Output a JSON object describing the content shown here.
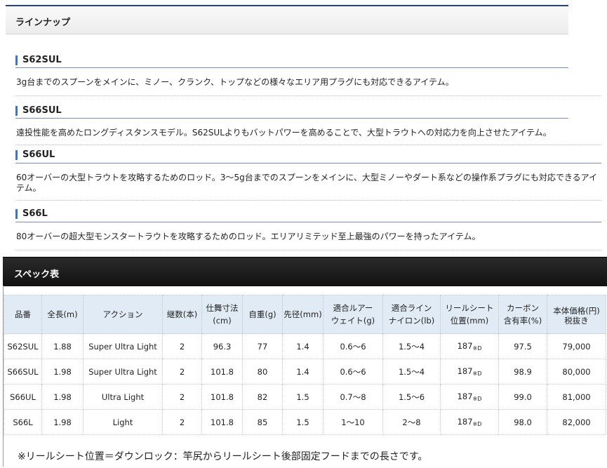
{
  "lineup": {
    "title": "ラインナップ"
  },
  "items": [
    {
      "model": "S62SUL",
      "desc": "3g台までのスプーンをメインに、ミノー、クランク、トップなどの様々なエリア用プラグにも対応できるアイテム。"
    },
    {
      "model": "S66SUL",
      "desc": "遠投性能を高めたロングディスタンスモデル。S62SULよりもバットパワーを高めることで、大型トラウトへの対応力を向上させたアイテム。"
    },
    {
      "model": "S66UL",
      "desc": "60オーバーの大型トラウトを攻略するためのロッド。3～5g台までのスプーンをメインに、大型ミノーやダート系などの操作系プラグにも対応できるアイテム。"
    },
    {
      "model": "S66L",
      "desc": "80オーバーの超大型モンスタートラウトを攻略するためのロッド。エリアリミテッド至上最強のパワーを持ったアイテム。"
    }
  ],
  "spec": {
    "title": "スペック表",
    "headers": [
      [
        "品番"
      ],
      [
        "全長(m)"
      ],
      [
        "アクション"
      ],
      [
        "継数(本)"
      ],
      [
        "仕舞寸法",
        "(cm)"
      ],
      [
        "自重(g)"
      ],
      [
        "先径(mm)"
      ],
      [
        "適合ルアー",
        "ウェイト(g)"
      ],
      [
        "適合ライン",
        "ナイロン(lb)"
      ],
      [
        "リールシート",
        "位置(mm)"
      ],
      [
        "カーボン",
        "含有率(%)"
      ],
      [
        "本体価格(円)",
        "税抜き"
      ]
    ],
    "seat_suffix": "※D",
    "rows": [
      [
        "S62SUL",
        "1.88",
        "Super Ultra Light",
        "2",
        "96.3",
        "77",
        "1.4",
        "0.6～6",
        "1.5～4",
        "187",
        "97.5",
        "79,000"
      ],
      [
        "S66SUL",
        "1.98",
        "Super Ultra Light",
        "2",
        "101.8",
        "80",
        "1.4",
        "0.6～6",
        "1.5～4",
        "187",
        "98.9",
        "80,000"
      ],
      [
        "S66UL",
        "1.98",
        "Ultra Light",
        "2",
        "101.8",
        "82",
        "1.5",
        "0.7～8",
        "1.5～6",
        "187",
        "99.0",
        "81,000"
      ],
      [
        "S66L",
        "1.98",
        "Light",
        "2",
        "101.8",
        "85",
        "1.5",
        "1～10",
        "2～8",
        "187",
        "98.0",
        "82,000"
      ]
    ],
    "note": "※リールシート位置＝ダウンロック：竿尻からリールシート後部固定フードまでの長さです。"
  }
}
